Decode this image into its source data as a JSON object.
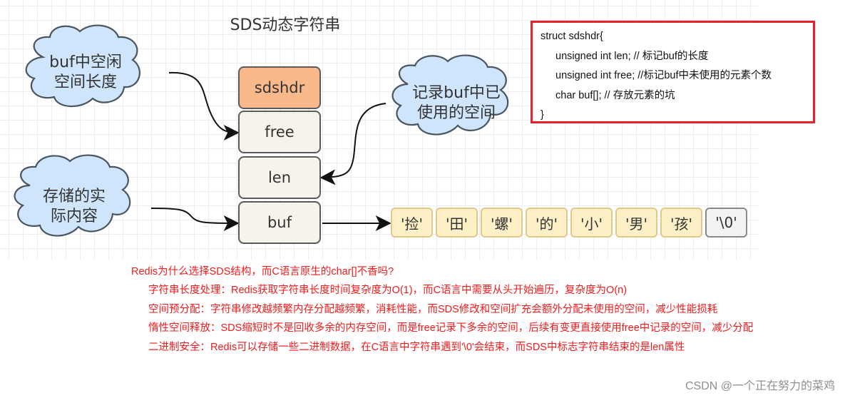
{
  "diagram": {
    "title": "SDS动态字符串",
    "clouds": [
      {
        "id": "free-note",
        "text": "buf中空闲\n空间长度"
      },
      {
        "id": "len-note",
        "text": "记录buf中已\n使用的空间"
      },
      {
        "id": "buf-note",
        "text": "存储的实\n际内容"
      }
    ],
    "struct_fields": [
      {
        "label": "sdshdr",
        "role": "header"
      },
      {
        "label": "free",
        "role": "field"
      },
      {
        "label": "len",
        "role": "field"
      },
      {
        "label": "buf",
        "role": "field"
      }
    ],
    "buffer_chars": [
      "'捡'",
      "'田'",
      "'螺'",
      "'的'",
      "'小'",
      "'男'",
      "'孩'",
      "'\\0'"
    ],
    "colors": {
      "cloud_fill": "#cfe5fb",
      "header_fill": "#f9b98a",
      "field_fill": "#f6f3ea",
      "char_fill": "#fdf0c6",
      "terminator_fill": "#f3f3f3",
      "accent_red": "#e8202a"
    }
  },
  "code": {
    "lines": [
      "struct sdshdr{",
      "unsigned int len; // 标记buf的长度",
      "unsigned int free; //标记buf中未使用的元素个数",
      "char buf[]; // 存放元素的坑",
      "}"
    ]
  },
  "notes": {
    "question": "Redis为什么选择SDS结构，而C语言原生的char[]不香吗?",
    "items": [
      "字符串长度处理：Redis获取字符串长度时间复杂度为O(1)，而C语言中需要从头开始遍历，复杂度为O(n)",
      "空间预分配：字符串修改越频繁内存分配越频繁，消耗性能，而SDS修改和空间扩充会额外分配未使用的空间，减少性能损耗",
      "惰性空间释放：SDS缩短时不是回收多余的内存空间，而是free记录下多余的空间，后续有变更直接使用free中记录的空间，减少分配",
      "二进制安全：Redis可以存储一些二进制数据，在C语言中字符串遇到'\\0'会结束，而SDS中标志字符串结束的是len属性"
    ]
  },
  "watermark": "CSDN @一个正在努力的菜鸡"
}
